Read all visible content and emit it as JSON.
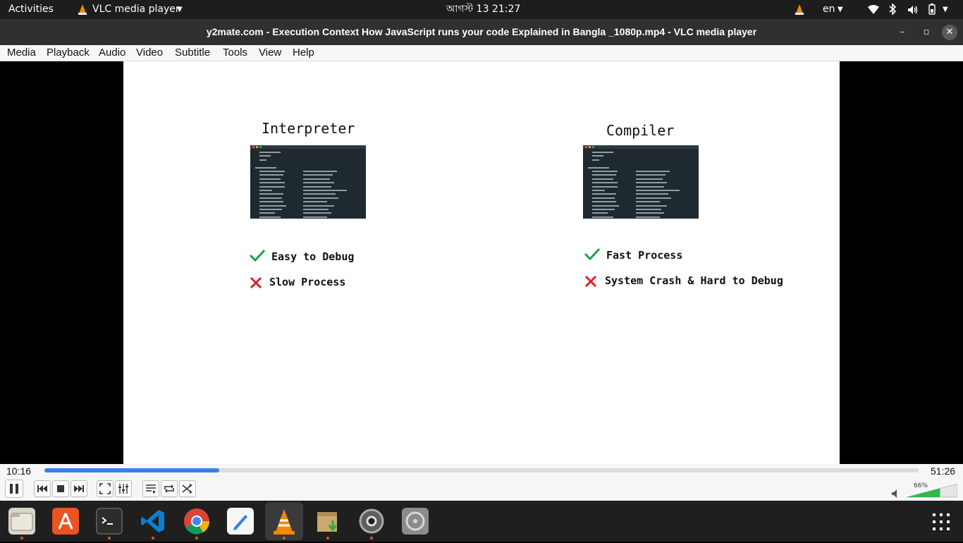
{
  "topbar": {
    "activities": "Activities",
    "app_menu": "VLC media player",
    "clock": "আগস্ট 13  21:27",
    "lang": "en"
  },
  "window": {
    "title": "y2mate.com - Execution Context  How JavaScript runs your code  Explained in Bangla _1080p.mp4 - VLC media player"
  },
  "menu": [
    "Media",
    "Playback",
    "Audio",
    "Video",
    "Subtitle",
    "Tools",
    "View",
    "Help"
  ],
  "slide": {
    "left": {
      "heading": "Interpreter",
      "pro": "Easy to Debug",
      "con": "Slow Process"
    },
    "right": {
      "heading": "Compiler",
      "pro": "Fast Process",
      "con": "System Crash & Hard to Debug"
    }
  },
  "player": {
    "elapsed": "10:16",
    "total": "51:26",
    "progress": 0.2,
    "volume_label": "66%",
    "volume": 0.66
  },
  "colors": {
    "accent": "#3584e4",
    "check": "#1e9e4a",
    "cross": "#e01b24",
    "dock_indicator": "#e95420"
  },
  "dock": {
    "apps": [
      "files-icon",
      "software-icon",
      "terminal-icon",
      "vscode-icon",
      "chrome-icon",
      "text-editor-icon",
      "vlc-icon",
      "archive-manager-icon",
      "settings-icon",
      "disk-icon"
    ]
  }
}
